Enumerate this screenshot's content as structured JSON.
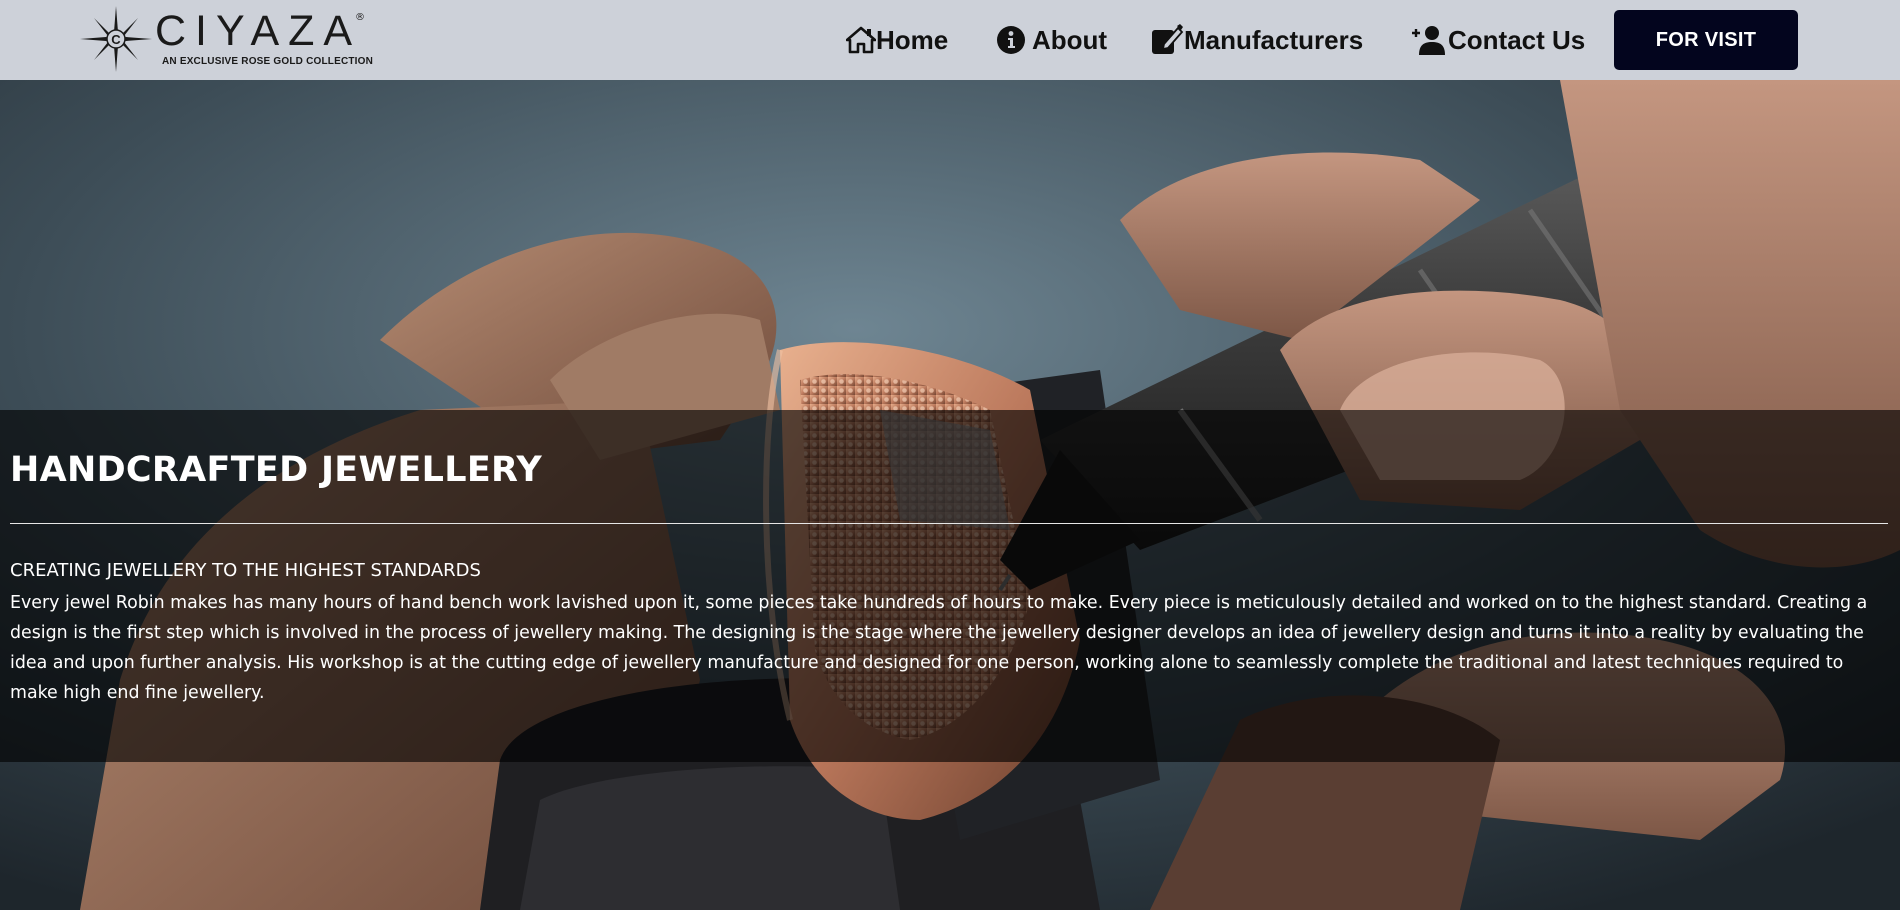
{
  "brand": {
    "name": "CIYAZA",
    "registered_mark": "®",
    "tagline": "AN EXCLUSIVE ROSE GOLD COLLECTION",
    "logo_icon": "compass-star-icon"
  },
  "nav": {
    "items": [
      {
        "label": "Home",
        "icon": "home-icon"
      },
      {
        "label": "About",
        "icon": "info-circle-icon"
      },
      {
        "label": "Manufacturers",
        "icon": "edit-pen-icon"
      },
      {
        "label": "Contact Us",
        "icon": "user-plus-icon"
      }
    ],
    "cta_label": "FOR VISIT"
  },
  "hero": {
    "image": "hands-engraving-rose-gold-ring-photo",
    "heading": "HANDCRAFTED JEWELLERY",
    "subheading": "CREATING JEWELLERY TO THE HIGHEST STANDARDS",
    "body": "Every jewel Robin makes has many hours of hand bench work lavished upon it, some pieces take hundreds of hours to make. Every piece is meticulously detailed and worked on to the highest standard. Creating a design is the first step which is involved in the process of jewellery making. The designing is the stage where the jewellery designer develops an idea of jewellery design and turns it into a reality by evaluating the idea and upon further analysis. His workshop is at the cutting edge of jewellery manufacture and designed for one person, working alone to seamlessly complete the traditional and latest techniques required to make high end fine jewellery."
  },
  "colors": {
    "header_bg": "#cdd1d9",
    "cta_bg": "#03051e",
    "overlay": "rgba(0,0,0,0.62)",
    "text_light": "#ffffff"
  }
}
